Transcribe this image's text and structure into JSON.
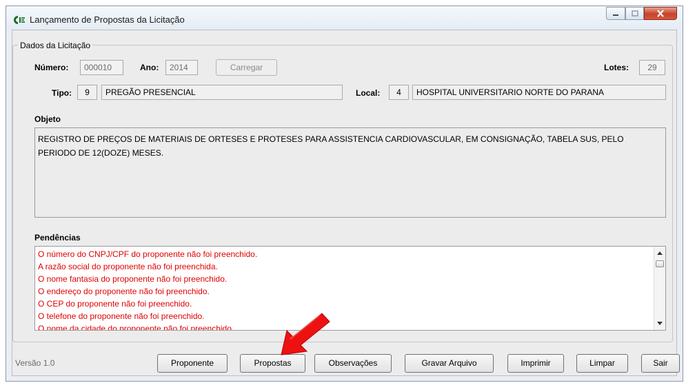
{
  "window": {
    "title": "Lançamento de Propostas da Licitação"
  },
  "dados": {
    "legend": "Dados da Licitação",
    "numero_label": "Número:",
    "numero_value": "000010",
    "ano_label": "Ano:",
    "ano_value": "2014",
    "carregar_label": "Carregar",
    "lotes_label": "Lotes:",
    "lotes_value": "29",
    "tipo_label": "Tipo:",
    "tipo_code": "9",
    "tipo_desc": "PREGÃO PRESENCIAL",
    "local_label": "Local:",
    "local_code": "4",
    "local_desc": "HOSPITAL UNIVERSITARIO NORTE DO PARANA"
  },
  "objeto": {
    "label": "Objeto",
    "text": "REGISTRO DE PREÇOS DE MATERIAIS DE ORTESES E PROTESES PARA ASSISTENCIA CARDIOVASCULAR, EM CONSIGNAÇÃO, TABELA SUS, PELO PERIODO DE 12(DOZE) MESES."
  },
  "pendencias": {
    "label": "Pendências",
    "items": [
      "O número do CNPJ/CPF do proponente não foi preenchido.",
      "A razão social do proponente não foi preenchida.",
      "O nome fantasia do proponente não foi preenchido.",
      "O endereço do proponente não foi preenchido.",
      "O CEP do proponente não foi preenchido.",
      "O telefone do proponente não foi preenchido.",
      "O nome da cidade do proponente não foi preenchido."
    ]
  },
  "footer": {
    "version": "Versão 1.0",
    "buttons": {
      "proponente": "Proponente",
      "propostas": "Propostas",
      "observacoes": "Observações",
      "gravar": "Gravar Arquivo",
      "imprimir": "Imprimir",
      "limpar": "Limpar",
      "sair": "Sair"
    }
  },
  "colors": {
    "error_text": "#e00000",
    "annotation_arrow": "#ee1111"
  }
}
